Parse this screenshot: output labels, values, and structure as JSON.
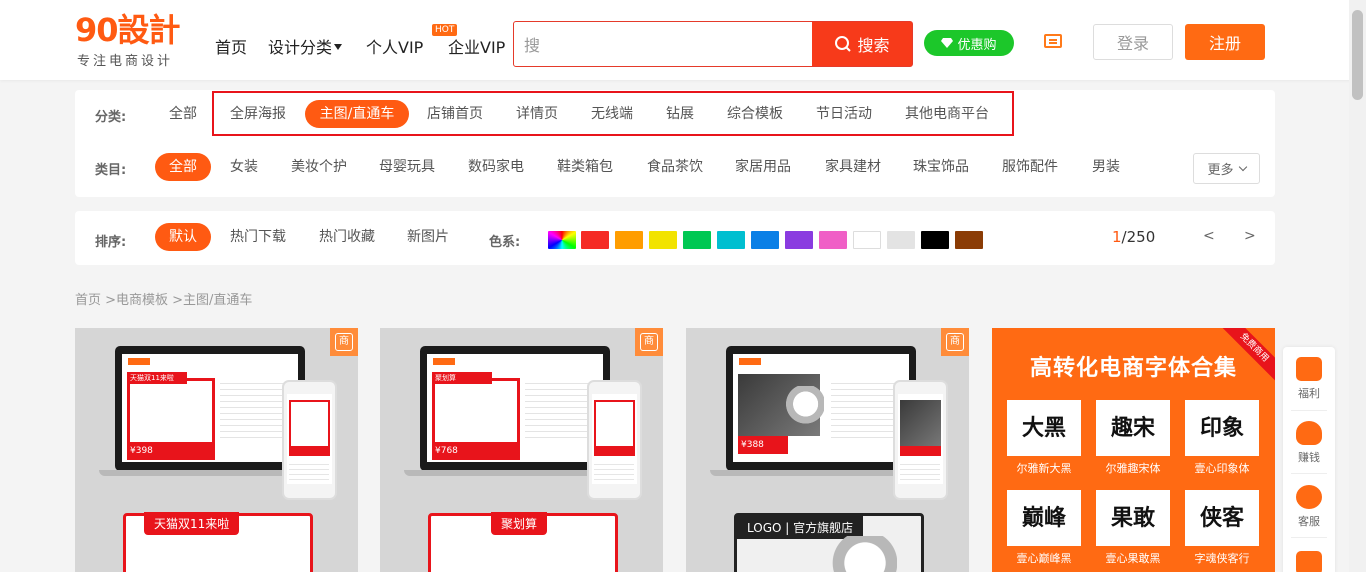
{
  "logo": {
    "main": "90設計",
    "sub": "专注电商设计"
  },
  "nav": {
    "home": "首页",
    "categories": "设计分类",
    "personal_vip": "个人VIP",
    "hot_badge": "HOT",
    "enterprise_vip": "企业VIP"
  },
  "search": {
    "value": "搜",
    "button": "搜索"
  },
  "header": {
    "coupon": "优惠购",
    "login": "登录",
    "register": "注册"
  },
  "filters": {
    "category_label": "分类:",
    "categories": [
      "全部",
      "全屏海报",
      "主图/直通车",
      "店铺首页",
      "详情页",
      "无线端",
      "钻展",
      "综合模板",
      "节日活动",
      "其他电商平台"
    ],
    "type_label": "类目:",
    "types": [
      "全部",
      "女装",
      "美妆个护",
      "母婴玩具",
      "数码家电",
      "鞋类箱包",
      "食品茶饮",
      "家居用品",
      "家具建材",
      "珠宝饰品",
      "服饰配件",
      "男装"
    ],
    "more": "更多"
  },
  "sort": {
    "label": "排序:",
    "options": [
      "默认",
      "热门下载",
      "热门收藏",
      "新图片"
    ],
    "color_label": "色系:",
    "colors": [
      "#f52a24",
      "#ff9d00",
      "#f2e300",
      "#00c853",
      "#00bfd0",
      "#0a7fe6",
      "#8a3be0",
      "#f05fc6",
      "#ffffff",
      "#e3e3e3",
      "#000000",
      "#8b3c05"
    ],
    "page_current": "1",
    "page_total": "/250",
    "prev": "<",
    "next": ">"
  },
  "breadcrumb": "首页 >电商模板 >主图/直通车",
  "cards": [
    {
      "badge": "商",
      "tag": "天猫双11来啦",
      "price": "¥398",
      "logo": ""
    },
    {
      "badge": "商",
      "tag": "聚划算",
      "price": "¥768",
      "logo": ""
    },
    {
      "badge": "商",
      "tag": "LOGO | 官方旗舰店",
      "price": "¥388",
      "logo": "LOGO"
    }
  ],
  "promo": {
    "ribbon": "免费商用",
    "title": "高转化电商字体合集",
    "fonts": [
      {
        "glyph": "大黑",
        "caption": "尔雅新大黑"
      },
      {
        "glyph": "趣宋",
        "caption": "尔雅趣宋体"
      },
      {
        "glyph": "印象",
        "caption": "壹心印象体"
      },
      {
        "glyph": "巅峰",
        "caption": "壹心巅峰黑"
      },
      {
        "glyph": "果敢",
        "caption": "壹心果敢黑"
      },
      {
        "glyph": "侠客",
        "caption": "字魂侠客行"
      }
    ]
  },
  "sidebar": {
    "items": [
      "福利",
      "赚钱",
      "客服"
    ]
  }
}
